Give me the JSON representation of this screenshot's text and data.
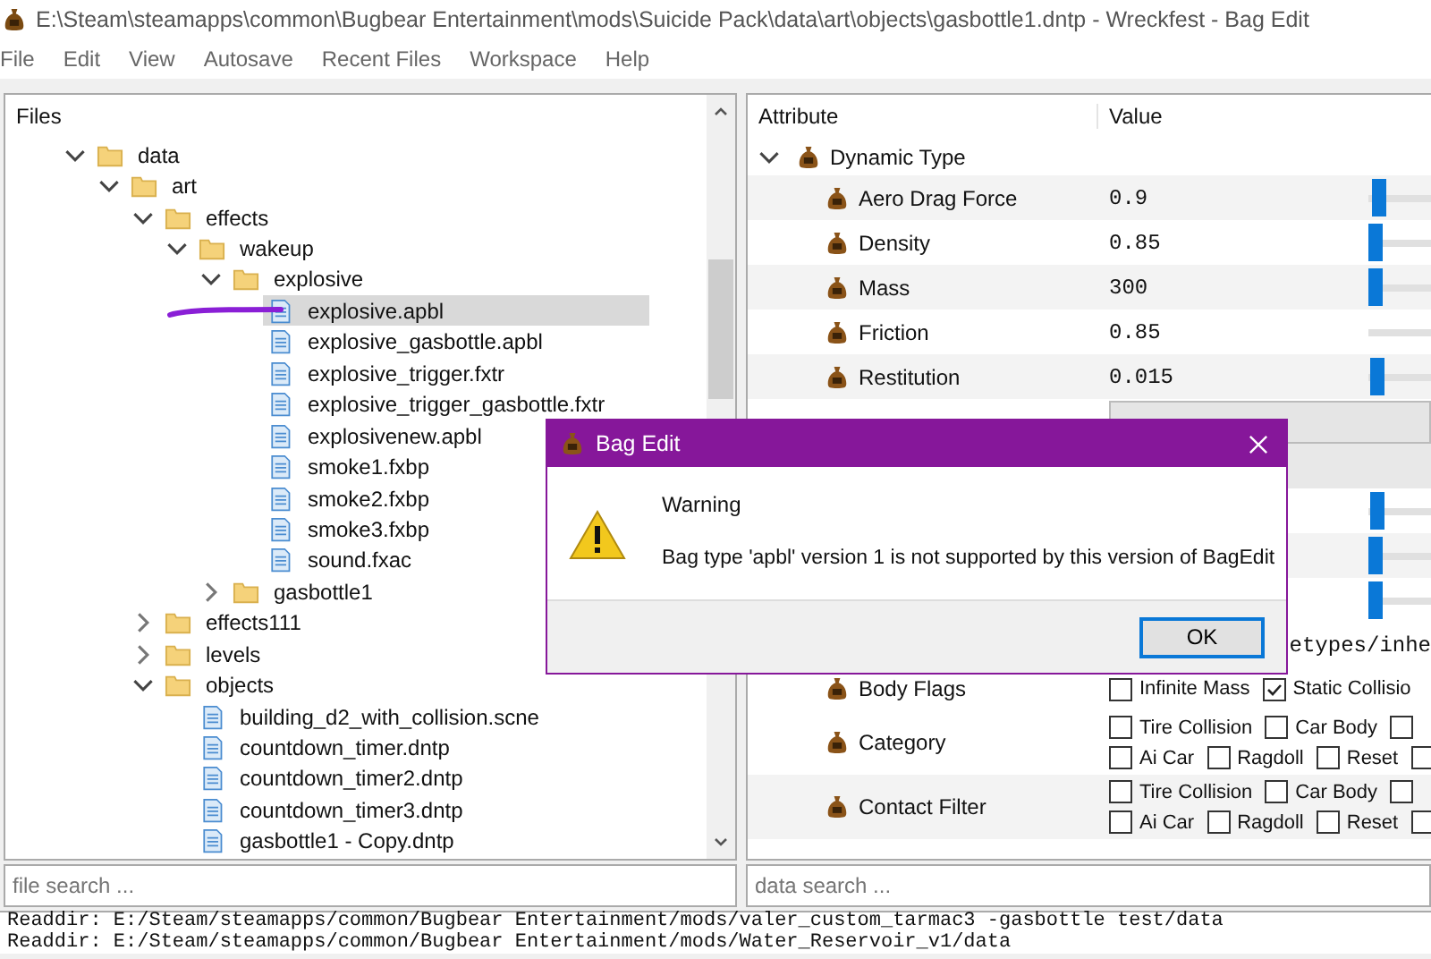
{
  "window": {
    "title": "E:\\Steam\\steamapps\\common\\Bugbear Entertainment\\mods\\Suicide Pack\\data\\art\\objects\\gasbottle1.dntp - Wreckfest - Bag Edit"
  },
  "menu": [
    "File",
    "Edit",
    "View",
    "Autosave",
    "Recent Files",
    "Workspace",
    "Help"
  ],
  "files_panel": {
    "header": "Files",
    "tree": [
      {
        "name": "data",
        "kind": "folder",
        "expanded": true,
        "selected": false,
        "children": [
          {
            "name": "art",
            "kind": "folder",
            "expanded": true,
            "selected": false,
            "children": [
              {
                "name": "effects",
                "kind": "folder",
                "expanded": true,
                "selected": false,
                "children": [
                  {
                    "name": "wakeup",
                    "kind": "folder",
                    "expanded": true,
                    "selected": false,
                    "children": [
                      {
                        "name": "explosive",
                        "kind": "folder",
                        "expanded": true,
                        "selected": false,
                        "children": [
                          {
                            "name": "explosive.apbl",
                            "kind": "file",
                            "selected": true
                          },
                          {
                            "name": "explosive_gasbottle.apbl",
                            "kind": "file",
                            "selected": false
                          },
                          {
                            "name": "explosive_trigger.fxtr",
                            "kind": "file",
                            "selected": false
                          },
                          {
                            "name": "explosive_trigger_gasbottle.fxtr",
                            "kind": "file",
                            "selected": false
                          },
                          {
                            "name": "explosivenew.apbl",
                            "kind": "file",
                            "selected": false
                          },
                          {
                            "name": "smoke1.fxbp",
                            "kind": "file",
                            "selected": false
                          },
                          {
                            "name": "smoke2.fxbp",
                            "kind": "file",
                            "selected": false
                          },
                          {
                            "name": "smoke3.fxbp",
                            "kind": "file",
                            "selected": false
                          },
                          {
                            "name": "sound.fxac",
                            "kind": "file",
                            "selected": false
                          }
                        ]
                      },
                      {
                        "name": "gasbottle1",
                        "kind": "folder",
                        "expanded": false,
                        "selected": false
                      }
                    ]
                  }
                ]
              },
              {
                "name": "effects111",
                "kind": "folder",
                "expanded": false,
                "selected": false
              },
              {
                "name": "levels",
                "kind": "folder",
                "expanded": false,
                "selected": false
              },
              {
                "name": "objects",
                "kind": "folder",
                "expanded": true,
                "selected": false,
                "children": [
                  {
                    "name": "building_d2_with_collision.scne",
                    "kind": "file",
                    "selected": false
                  },
                  {
                    "name": "countdown_timer.dntp",
                    "kind": "file",
                    "selected": false
                  },
                  {
                    "name": "countdown_timer2.dntp",
                    "kind": "file",
                    "selected": false
                  },
                  {
                    "name": "countdown_timer3.dntp",
                    "kind": "file",
                    "selected": false
                  },
                  {
                    "name": "gasbottle1 - Copy.dntp",
                    "kind": "file",
                    "selected": false
                  }
                ]
              }
            ]
          }
        ]
      }
    ]
  },
  "attributes_panel": {
    "columns": [
      "Attribute",
      "Value"
    ],
    "rows": [
      {
        "kind": "group",
        "name": "Dynamic Type",
        "expanded": true,
        "children": [
          {
            "kind": "number",
            "name": "Aero Drag Force",
            "value": "0.9",
            "level": 0.06
          },
          {
            "kind": "number",
            "name": "Density",
            "value": "0.85",
            "level": 0.0
          },
          {
            "kind": "number",
            "name": "Mass",
            "value": "300",
            "level": 0.0
          },
          {
            "kind": "number",
            "name": "Friction",
            "value": "0.85"
          },
          {
            "kind": "number",
            "name": "Restitution",
            "value": "0.015",
            "level": 0.03
          },
          {
            "kind": "dropdown"
          },
          {
            "kind": "band"
          },
          {
            "kind": "number",
            "level": 0.03
          },
          {
            "kind": "number",
            "level": 0.0
          },
          {
            "kind": "number",
            "level": 0.0
          },
          {
            "kind": "path",
            "value": "etypes/inhe"
          },
          {
            "kind": "flags",
            "name": "Body Flags",
            "lines": [
              {
                "options": [
                  {
                    "label": "Infinite Mass",
                    "checked": false
                  },
                  {
                    "label": "Static Collisio",
                    "checked": true
                  }
                ]
              }
            ]
          },
          {
            "kind": "flags",
            "name": "Category",
            "lines": [
              {
                "options": [
                  {
                    "label": "Tire Collision",
                    "checked": false
                  },
                  {
                    "label": "Car Body",
                    "checked": false
                  },
                  {
                    "checked": false
                  }
                ]
              },
              {
                "options": [
                  {
                    "label": "Ai Car",
                    "checked": false
                  },
                  {
                    "label": "Ragdoll",
                    "checked": false
                  },
                  {
                    "label": "Reset",
                    "checked": false
                  },
                  {
                    "checked": false
                  }
                ]
              }
            ]
          },
          {
            "kind": "flags",
            "name": "Contact Filter",
            "lines": [
              {
                "options": [
                  {
                    "label": "Tire Collision",
                    "checked": false
                  },
                  {
                    "label": "Car Body",
                    "checked": false
                  },
                  {
                    "checked": false
                  }
                ]
              },
              {
                "options": [
                  {
                    "label": "Ai Car",
                    "checked": false
                  },
                  {
                    "label": "Ragdoll",
                    "checked": false
                  },
                  {
                    "label": "Reset",
                    "checked": false
                  },
                  {
                    "checked": false
                  }
                ]
              }
            ]
          }
        ]
      }
    ]
  },
  "file_search": {
    "placeholder": "file search ..."
  },
  "data_search": {
    "placeholder": "data search ..."
  },
  "log": [
    "Readdir: E:/Steam/steamapps/common/Bugbear Entertainment/mods/valer_custom_tarmac3 -gasbottle test/data",
    "Readdir: E:/Steam/steamapps/common/Bugbear Entertainment/mods/Water_Reservoir_v1/data"
  ],
  "dialog": {
    "title": "Bag Edit",
    "heading": "Warning",
    "message": "Bag type 'apbl' version 1 is not supported by this version of BagEdit",
    "button": "OK"
  }
}
